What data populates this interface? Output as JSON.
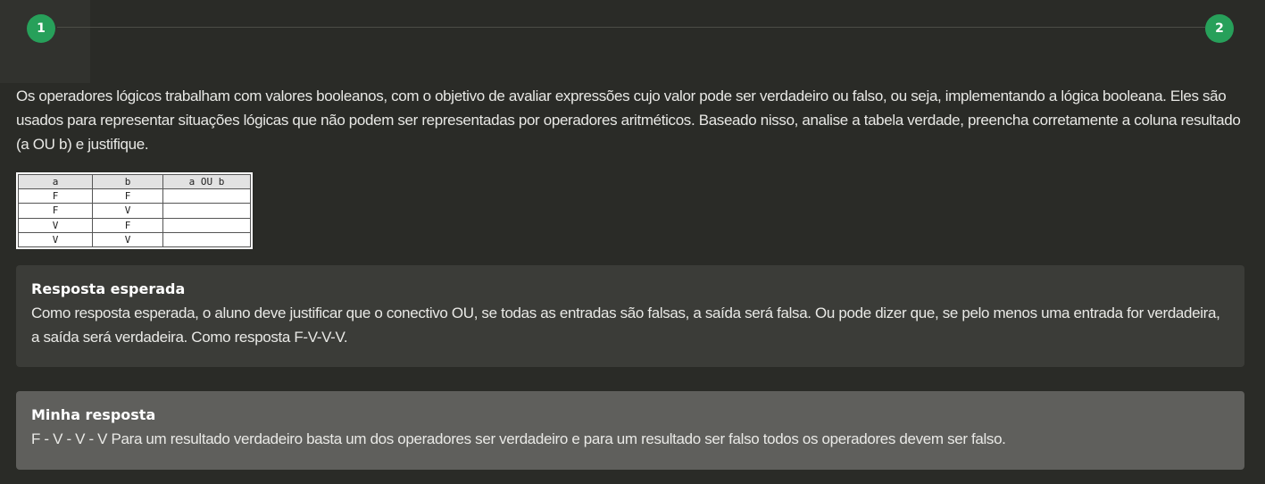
{
  "stepper": {
    "steps": [
      "1",
      "2"
    ]
  },
  "question": {
    "text": "Os operadores lógicos trabalham com valores booleanos, com o objetivo de avaliar expressões cujo valor pode ser verdadeiro ou falso, ou seja, implementando a lógica booleana. Eles são usados para representar situações lógicas que não podem ser representadas por operadores aritméticos. Baseado nisso, analise a tabela verdade, preencha corretamente a coluna resultado (a OU b) e justifique."
  },
  "truth_table": {
    "headers": [
      "a",
      "b",
      "a OU b"
    ],
    "rows": [
      [
        "F",
        "F",
        ""
      ],
      [
        "F",
        "V",
        ""
      ],
      [
        "V",
        "F",
        ""
      ],
      [
        "V",
        "V",
        ""
      ]
    ]
  },
  "expected_answer": {
    "title": "Resposta esperada",
    "body": "Como resposta esperada, o aluno deve justificar que o conectivo OU, se todas as entradas são falsas, a saída será falsa. Ou pode dizer que, se pelo menos uma entrada for verdadeira, a saída será verdadeira. Como resposta F-V-V-V."
  },
  "my_answer": {
    "title": "Minha resposta",
    "body": "F - V - V - V Para um resultado verdadeiro basta um dos operadores ser verdadeiro e para um resultado ser falso todos os operadores devem ser falso."
  },
  "colors": {
    "background": "#2a2b27",
    "step_accent": "#27a05a",
    "expected_card": "#3b3c38",
    "mine_card": "#5f5f5c"
  }
}
